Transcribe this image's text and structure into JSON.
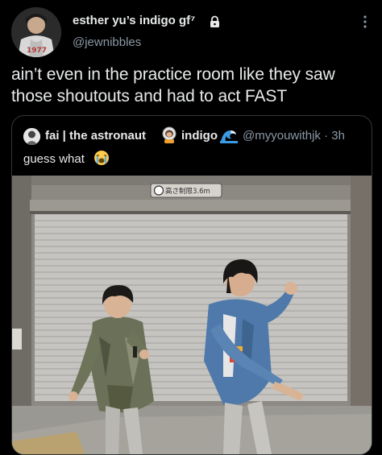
{
  "tweet": {
    "display_name": "esther yu’s indigo gf⁷",
    "handle": "@jewnibbles",
    "text": "ain’t even in the practice room like they saw those shoutouts and had to act FAST"
  },
  "avatar_jersey_text": "1977",
  "quote": {
    "display_name": "fai | the astronaut",
    "display_name_suffix": "indigo",
    "handle_time": "@myyouwithjk · 3h",
    "text": "guess what",
    "media": {
      "sign_text": "高さ制限3.6m"
    }
  },
  "icons": {
    "lock": "lock-icon",
    "more": "more-options-icon",
    "astronaut": "astronaut-emoji-icon",
    "wave": "wave-emoji-icon",
    "crying": "crying-face-emoji-icon"
  },
  "colors": {
    "background": "#000000",
    "primary_text": "#e7e9ea",
    "secondary_text": "#8b98a5",
    "card_border": "#333639"
  }
}
